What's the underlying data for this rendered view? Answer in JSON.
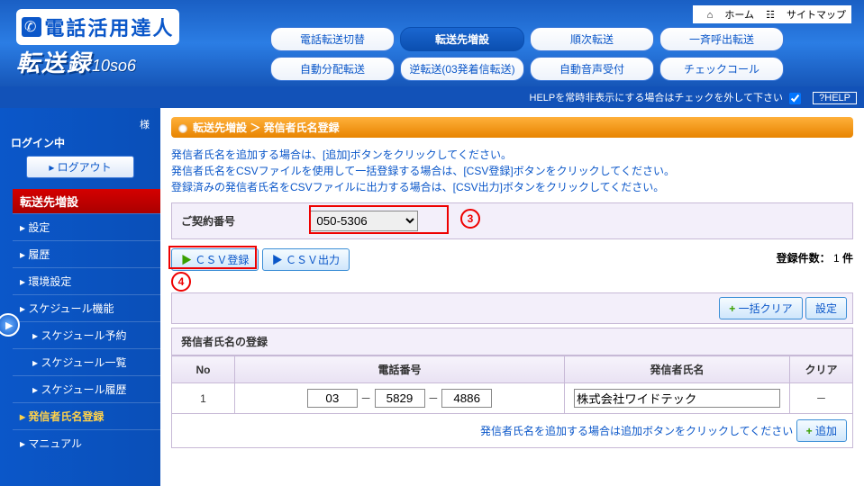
{
  "top_links": {
    "home": "ホーム",
    "sitemap": "サイトマップ"
  },
  "logo": {
    "line1": "電話活用達人",
    "line2": "転送録",
    "small": "10so6"
  },
  "nav": {
    "row1": [
      "電話転送切替",
      "転送先増設",
      "順次転送",
      "一斉呼出転送"
    ],
    "row2": [
      "自動分配転送",
      "逆転送(03発着信転送)",
      "自動音声受付",
      "チェックコール"
    ],
    "active": "転送先増設"
  },
  "help_bar": {
    "text": "HELPを常時非表示にする場合はチェックを外して下さい",
    "btn": "?HELP"
  },
  "sidebar": {
    "user_suffix": "様",
    "login_status": "ログイン中",
    "logout": "ログアウト",
    "section": "転送先増設",
    "items": [
      {
        "label": "設定",
        "sub": false
      },
      {
        "label": "履歴",
        "sub": false
      },
      {
        "label": "環境設定",
        "sub": false
      },
      {
        "label": "スケジュール機能",
        "sub": false
      },
      {
        "label": "スケジュール予約",
        "sub": true
      },
      {
        "label": "スケジュール一覧",
        "sub": true
      },
      {
        "label": "スケジュール履歴",
        "sub": true
      },
      {
        "label": "発信者氏名登録",
        "sub": false,
        "highlight": true
      },
      {
        "label": "マニュアル",
        "sub": false
      }
    ]
  },
  "breadcrumb": {
    "text": "転送先増設 ＞ 発信者氏名登録"
  },
  "info": {
    "line1": "発信者氏名を追加する場合は、[追加]ボタンをクリックしてください。",
    "line2": "発信者氏名をCSVファイルを使用して一括登録する場合は、[CSV登録]ボタンをクリックしてください。",
    "line3": "登録済みの発信者氏名をCSVファイルに出力する場合は、[CSV出力]ボタンをクリックしてください。"
  },
  "contract": {
    "label": "ご契約番号",
    "selected": "050-5306"
  },
  "annotations": {
    "circle3": "3",
    "circle4": "4"
  },
  "buttons": {
    "csv_register": "ＣＳＶ登録",
    "csv_export": "ＣＳＶ出力",
    "bulk_clear": "一括クリア",
    "settings": "設定",
    "add": "追加"
  },
  "count": {
    "label": "登録件数：",
    "value": "1",
    "unit": "件"
  },
  "table": {
    "section_title": "発信者氏名の登録",
    "headers": {
      "no": "No",
      "phone": "電話番号",
      "name": "発信者氏名",
      "clear": "クリア"
    },
    "rows": [
      {
        "no": "1",
        "phone": [
          "03",
          "5829",
          "4886"
        ],
        "sep": "－",
        "name": "株式会社ワイドテック",
        "clear": "－"
      }
    ],
    "add_hint": "発信者氏名を追加する場合は追加ボタンをクリックしてください"
  }
}
